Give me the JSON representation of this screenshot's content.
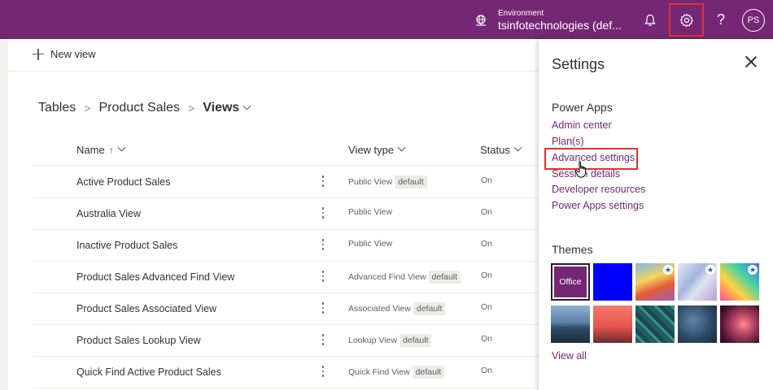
{
  "topbar": {
    "env_label": "Environment",
    "env_name": "tsinfotechnologies (def...",
    "avatar_initials": "PS",
    "help_glyph": "?",
    "bg_color": "#742774"
  },
  "main": {
    "new_view_label": "New view",
    "breadcrumb": {
      "tables": "Tables",
      "sep1": ">",
      "table": "Product Sales",
      "sep2": ">",
      "current": "Views"
    },
    "columns": {
      "name": "Name",
      "name_sort": "↑",
      "view_type": "View type",
      "status": "Status"
    },
    "rows": [
      {
        "name": "Active Product Sales",
        "type": "Public View",
        "badge": "default",
        "status": "On"
      },
      {
        "name": "Australia View",
        "type": "Public View",
        "badge": "",
        "status": "On"
      },
      {
        "name": "Inactive Product Sales",
        "type": "Public View",
        "badge": "",
        "status": "On"
      },
      {
        "name": "Product Sales Advanced Find View",
        "type": "Advanced Find View",
        "badge": "default",
        "status": "On"
      },
      {
        "name": "Product Sales Associated View",
        "type": "Associated View",
        "badge": "default",
        "status": "On"
      },
      {
        "name": "Product Sales Lookup View",
        "type": "Lookup View",
        "badge": "default",
        "status": "On"
      },
      {
        "name": "Quick Find Active Product Sales",
        "type": "Quick Find View",
        "badge": "default",
        "status": "On"
      }
    ]
  },
  "settings": {
    "title": "Settings",
    "section_power_apps": "Power Apps",
    "links": [
      "Admin center",
      "Plan(s)",
      "Advanced settings",
      "Session details",
      "Developer resources",
      "Power Apps settings"
    ],
    "section_themes": "Themes",
    "office_theme_label": "Office",
    "view_all": "View all",
    "highlight_color": "#e0312f",
    "link_color": "#742774"
  }
}
